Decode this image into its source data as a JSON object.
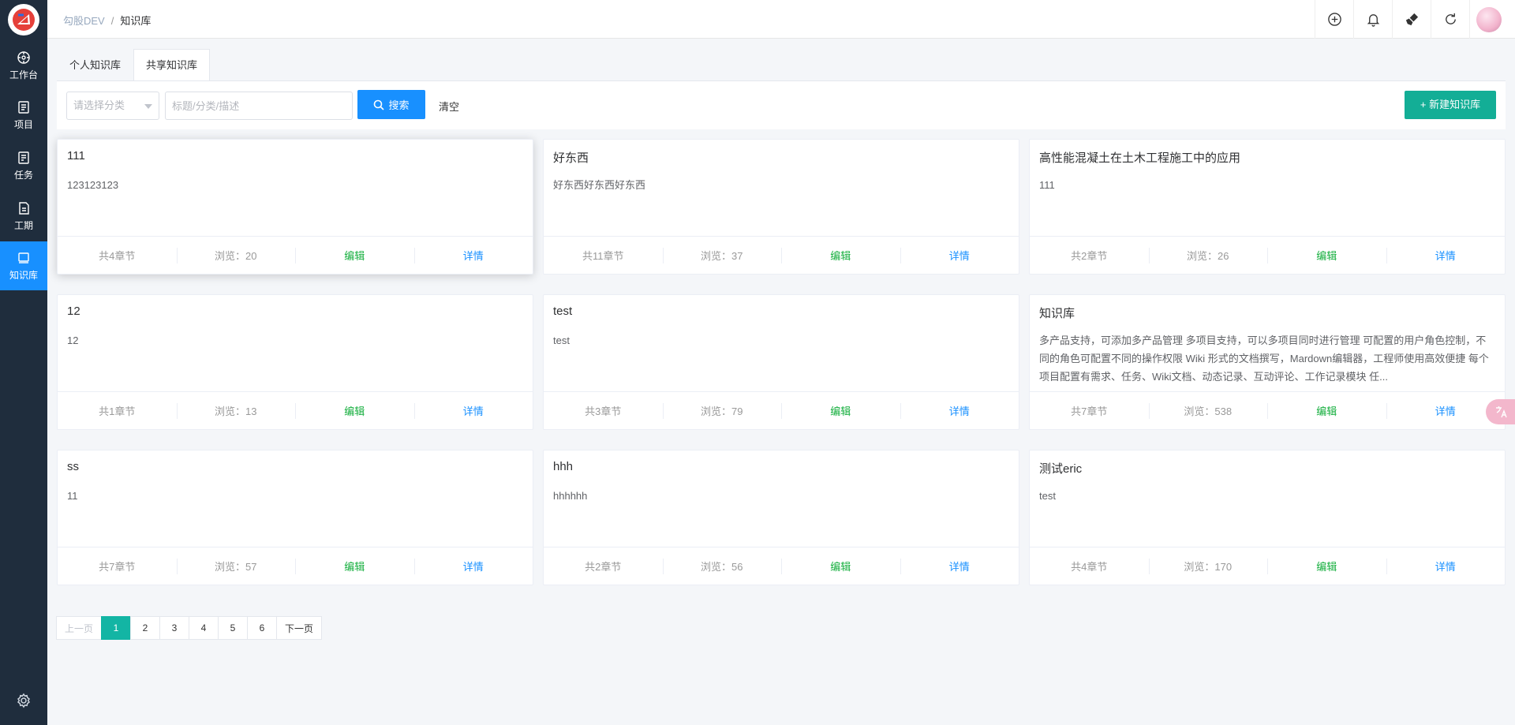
{
  "breadcrumb": {
    "root": "勾股DEV",
    "separator": "/",
    "current": "知识库"
  },
  "sidebar": {
    "items": [
      {
        "label": "工作台",
        "icon": "dashboard-icon"
      },
      {
        "label": "项目",
        "icon": "folder-icon"
      },
      {
        "label": "任务",
        "icon": "task-icon"
      },
      {
        "label": "工期",
        "icon": "schedule-icon"
      },
      {
        "label": "知识库",
        "icon": "book-icon",
        "active": true
      }
    ],
    "settings_icon": "gear-icon"
  },
  "header": {
    "buttons": [
      "plus-circle-icon",
      "bell-icon",
      "brush-icon",
      "refresh-icon",
      "avatar"
    ]
  },
  "tabs": [
    {
      "label": "个人知识库"
    },
    {
      "label": "共享知识库",
      "active": true
    }
  ],
  "toolbar": {
    "category_placeholder": "请选择分类",
    "keyword_placeholder": "标题/分类/描述",
    "search_label": "搜索",
    "clear_label": "清空",
    "new_label": "+ 新建知识库"
  },
  "cards": [
    {
      "title": "111",
      "desc": "123123123",
      "chapters": "共4章节",
      "views": "浏览：20",
      "edit": "编辑",
      "detail": "详情"
    },
    {
      "title": "好东西",
      "desc": "好东西好东西好东西",
      "chapters": "共11章节",
      "views": "浏览：37",
      "edit": "编辑",
      "detail": "详情"
    },
    {
      "title": "高性能混凝土在土木工程施工中的应用",
      "desc": "111",
      "chapters": "共2章节",
      "views": "浏览：26",
      "edit": "编辑",
      "detail": "详情"
    },
    {
      "title": "12",
      "desc": "12",
      "chapters": "共1章节",
      "views": "浏览：13",
      "edit": "编辑",
      "detail": "详情"
    },
    {
      "title": "test",
      "desc": "test",
      "chapters": "共3章节",
      "views": "浏览：79",
      "edit": "编辑",
      "detail": "详情"
    },
    {
      "title": "知识库",
      "desc": "多产品支持，可添加多产品管理 多项目支持，可以多项目同时进行管理 可配置的用户角色控制，不同的角色可配置不同的操作权限 Wiki 形式的文档撰写，Mardown编辑器，工程师使用高效便捷 每个项目配置有需求、任务、Wiki文档、动态记录、互动评论、工作记录模块 任...",
      "chapters": "共7章节",
      "views": "浏览：538",
      "edit": "编辑",
      "detail": "详情"
    },
    {
      "title": "ss",
      "desc": "11",
      "chapters": "共7章节",
      "views": "浏览：57",
      "edit": "编辑",
      "detail": "详情"
    },
    {
      "title": "hhh",
      "desc": "hhhhhh",
      "chapters": "共2章节",
      "views": "浏览：56",
      "edit": "编辑",
      "detail": "详情"
    },
    {
      "title": "测试eric",
      "desc": "test",
      "chapters": "共4章节",
      "views": "浏览：170",
      "edit": "编辑",
      "detail": "详情"
    }
  ],
  "pagination": {
    "prev": "上一页",
    "pages": [
      "1",
      "2",
      "3",
      "4",
      "5",
      "6"
    ],
    "current": "1",
    "next": "下一页"
  },
  "colors": {
    "sidebar": "#1f2d3d",
    "primary": "#1890ff",
    "accent": "#13ae96",
    "edit": "#13ae3c"
  }
}
